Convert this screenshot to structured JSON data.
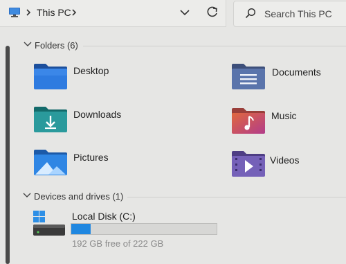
{
  "address": {
    "location": "This PC",
    "icons": [
      "monitor-icon",
      "chevron-right-icon",
      "chevron-down-icon",
      "refresh-icon"
    ]
  },
  "search": {
    "placeholder": "Search This PC",
    "icon": "search-icon"
  },
  "folders_section": {
    "title": "Folders (6)",
    "items": [
      {
        "label": "Desktop",
        "icon": "desktop-folder-icon"
      },
      {
        "label": "Documents",
        "icon": "documents-folder-icon"
      },
      {
        "label": "Downloads",
        "icon": "downloads-folder-icon"
      },
      {
        "label": "Music",
        "icon": "music-folder-icon"
      },
      {
        "label": "Pictures",
        "icon": "pictures-folder-icon"
      },
      {
        "label": "Videos",
        "icon": "videos-folder-icon"
      }
    ]
  },
  "drives_section": {
    "title": "Devices and drives (1)",
    "drives": [
      {
        "label": "Local Disk (C:)",
        "free_text": "192 GB free of 222 GB",
        "used_fraction": 0.135,
        "icon": "windows-drive-icon"
      }
    ]
  },
  "colors": {
    "accent": "#1f87e0",
    "background": "#e6e6e4"
  }
}
